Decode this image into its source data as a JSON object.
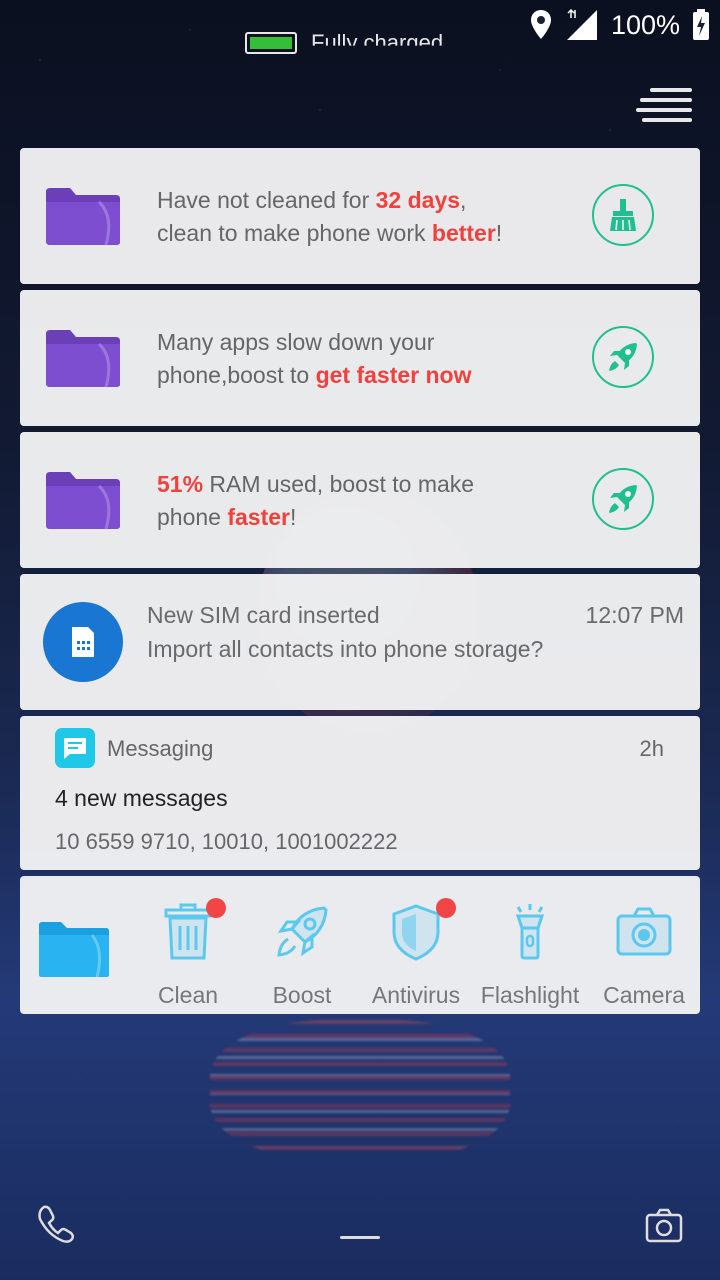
{
  "status_bar": {
    "battery_percent": "100%",
    "charging_text": "Fully charged"
  },
  "tips": [
    {
      "parts": [
        {
          "text": "Have not cleaned for ",
          "hl": false
        },
        {
          "text": "32 days",
          "hl": true
        },
        {
          "text": ",\nclean to make phone work ",
          "hl": false
        },
        {
          "text": "better",
          "hl": true
        },
        {
          "text": "!",
          "hl": false
        }
      ],
      "action_icon": "broom-icon"
    },
    {
      "parts": [
        {
          "text": "Many apps slow down your\nphone,boost to ",
          "hl": false
        },
        {
          "text": "get faster now",
          "hl": true
        }
      ],
      "action_icon": "rocket-icon"
    },
    {
      "parts": [
        {
          "text": "51%",
          "hl": true
        },
        {
          "text": " RAM used, boost to make\nphone ",
          "hl": false
        },
        {
          "text": "faster",
          "hl": true
        },
        {
          "text": "!",
          "hl": false
        }
      ],
      "action_icon": "rocket-icon"
    }
  ],
  "sim_notification": {
    "title": "New SIM card inserted",
    "time": "12:07 PM",
    "body": "Import all contacts into phone storage?"
  },
  "messaging": {
    "app_name": "Messaging",
    "time": "2h",
    "title": "4 new messages",
    "body": "10 6559 9710, 10010, 1001002222"
  },
  "toolbar": {
    "clean": "Clean",
    "boost": "Boost",
    "antivirus": "Antivirus",
    "flashlight": "Flashlight",
    "camera": "Camera"
  },
  "colors": {
    "accent_green": "#1fbf8f",
    "highlight_red": "#f2403d",
    "sim_blue": "#1976d2",
    "tool_blue": "#5bc8f0"
  }
}
